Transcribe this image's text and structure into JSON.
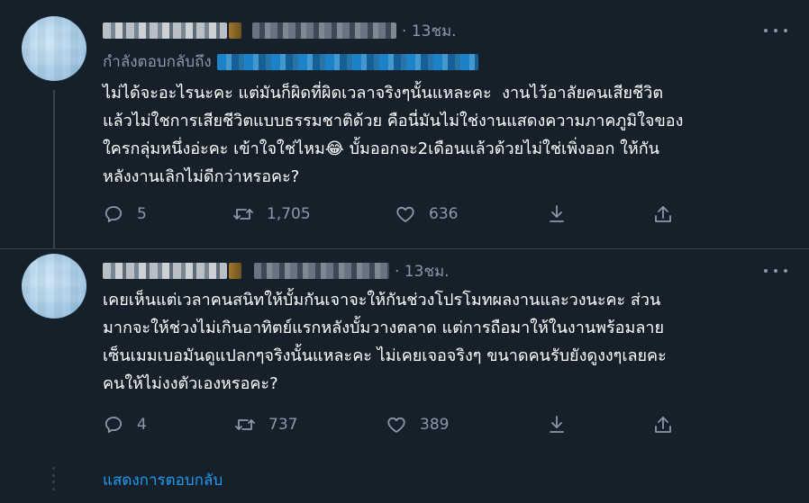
{
  "tweets": [
    {
      "time": "· 13ชม.",
      "reply_to_label": "กำลังตอบกลับถึง",
      "text": "ไม่ได้จะอะไรนะคะ แต่มันก็ผิดที่ผิดเวลาจริงๆนั้นแหละคะ  งานไว้อาลัยคนเสียชีวิต\nแล้วไม่ใชการเสียชีวิตแบบธรรมชาติด้วย คือนี่มันไม่ใช่งานแสดงความภาคภูมิใจของ\nใครกลุ่มหนึ่งอ่ะคะ เข้าใจใช่ไหม😂 บั้มออกจะ2เดือนแล้วด้วยไม่ใช่เพิ่งออก ให้กัน\nหลังงานเลิกไม่ดีกว่าหรอคะ?",
      "replies": "5",
      "retweets": "1,705",
      "likes": "636"
    },
    {
      "time": "· 13ชม.",
      "text": "เคยเห็นแต่เวลาคนสนิทให้บั้มกันเจาจะให้กันช่วงโปรโมทผลงานและวงนะคะ ส่วน\nมากจะให้ช่วงไม่เกินอาทิตย์แรกหลังบั้มวางตลาด แต่การถือมาให้ในงานพร้อมลาย\nเซ็นเมมเบอมันดูแปลกๆจริงนั้นแหละคะ ไม่เคยเจอจริงๆ ขนาดคนรับยังดูงงๆเลยคะ\nคนให้ไม่งงตัวเองหรอคะ?",
      "replies": "4",
      "retweets": "737",
      "likes": "389"
    }
  ],
  "show_replies_label": "แสดงการตอบกลับ",
  "icons": [
    "reply-icon",
    "retweet-icon",
    "like-icon",
    "share-icon",
    "more-icon"
  ],
  "colors": {
    "background": "#15202b",
    "muted": "#8b98a5",
    "accent": "#1d9bf0",
    "divider": "#38444d"
  }
}
